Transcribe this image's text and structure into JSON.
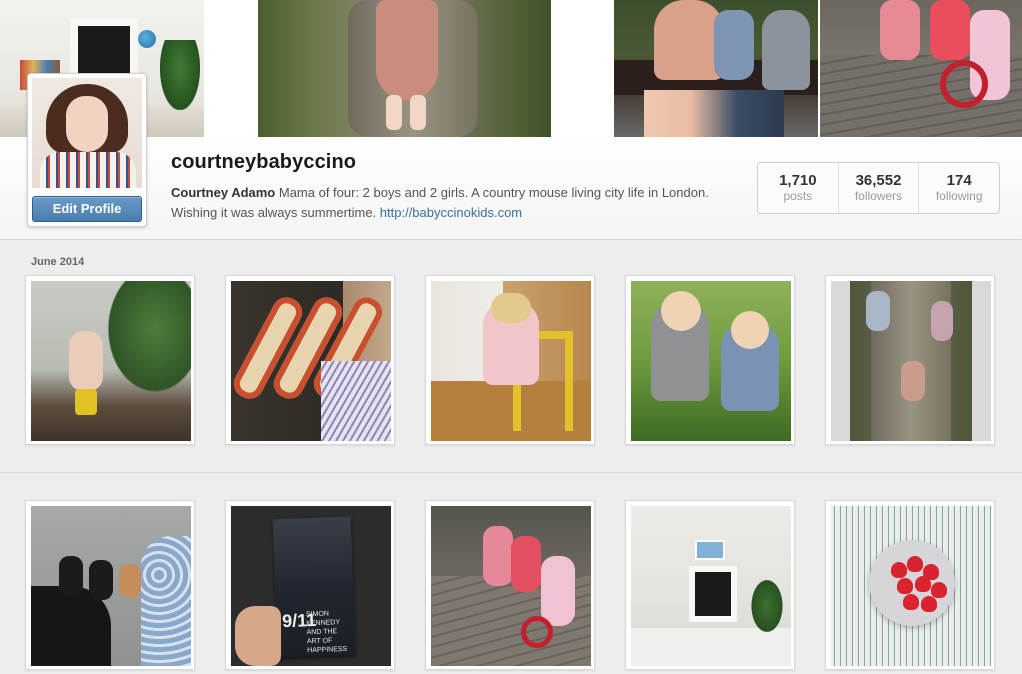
{
  "profile": {
    "username": "courtneybabyccino",
    "full_name": "Courtney Adamo",
    "bio": " Mama of four: 2 boys and 2 girls. A country mouse living city life in London. Wishing it was always summertime. ",
    "website": "http://babyccinokids.com",
    "edit_button_label": "Edit Profile"
  },
  "stats": [
    {
      "value": "1,710",
      "label": "posts"
    },
    {
      "value": "36,552",
      "label": "followers"
    },
    {
      "value": "174",
      "label": "following"
    }
  ],
  "grid": {
    "section_label": "June 2014",
    "book_title_text": "SIMON KENNEDY AND THE ART OF HAPPINESS",
    "book_number_text": "9/11"
  },
  "colors": {
    "link": "#3a6f9d",
    "button": "#4a7db0",
    "background": "#ededed"
  }
}
